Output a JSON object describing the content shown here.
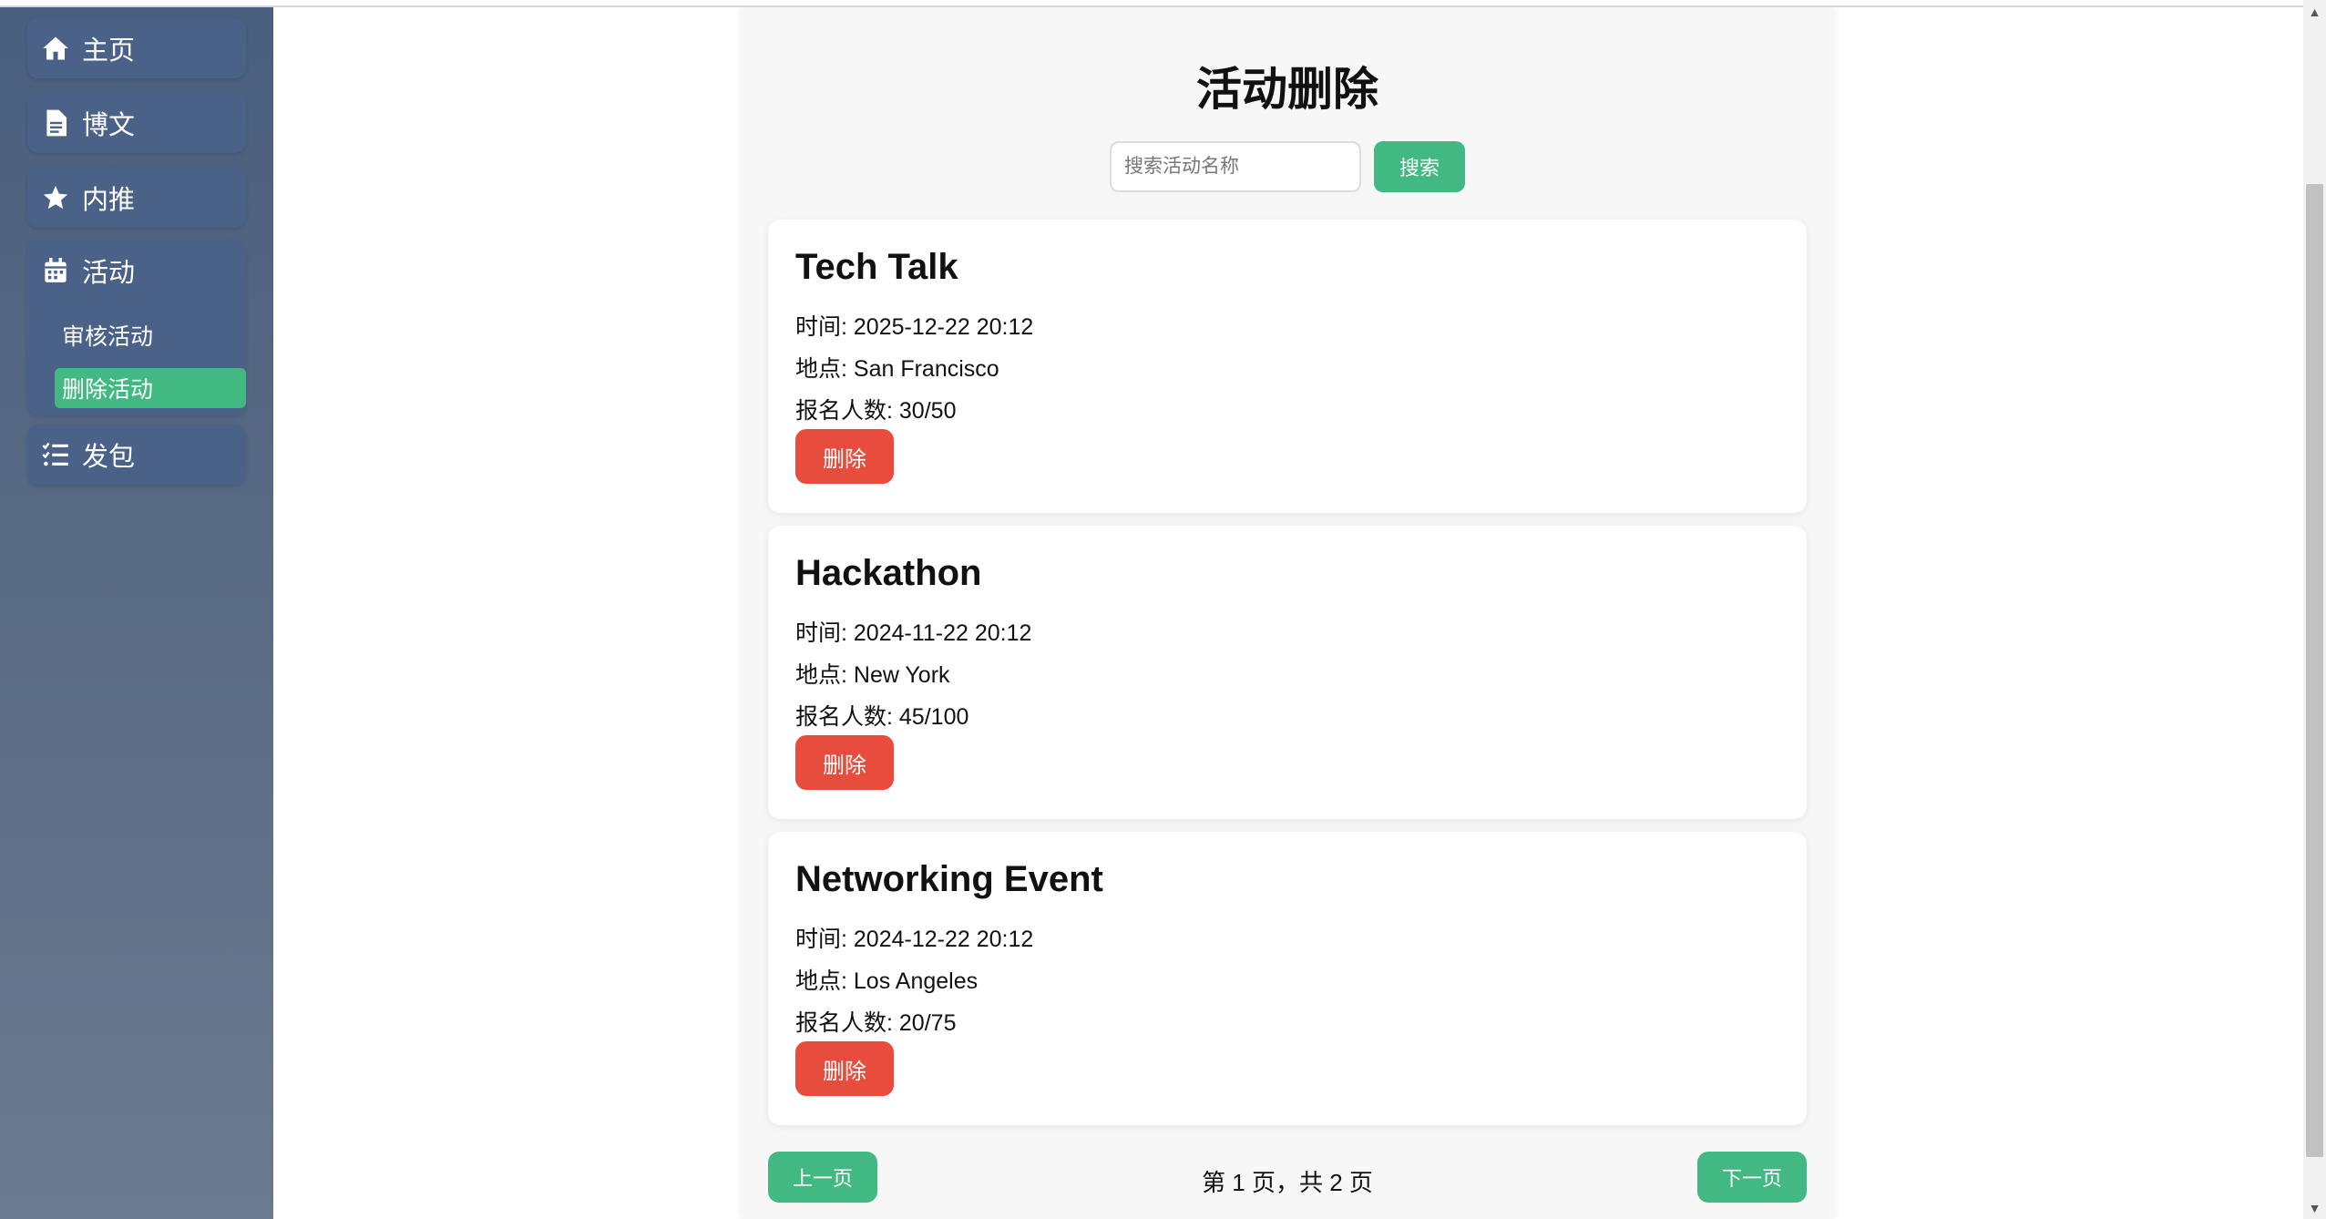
{
  "sidebar": {
    "items": [
      {
        "label": "主页",
        "icon": "home-icon"
      },
      {
        "label": "博文",
        "icon": "document-icon"
      },
      {
        "label": "内推",
        "icon": "star-icon"
      }
    ],
    "activity": {
      "label": "活动",
      "icon": "calendar-icon",
      "sub_items": [
        {
          "label": "审核活动",
          "active": false
        },
        {
          "label": "删除活动",
          "active": true
        }
      ]
    },
    "bottom_item": {
      "label": "发包",
      "icon": "checklist-icon"
    }
  },
  "main": {
    "title": "活动删除",
    "search": {
      "placeholder": "搜索活动名称",
      "value": "",
      "button_label": "搜索"
    },
    "events": [
      {
        "name": "Tech Talk",
        "time_label": "时间: ",
        "time": "2025-12-22 20:12",
        "location_label": "地点: ",
        "location": "San Francisco",
        "signup_label": "报名人数: ",
        "signup": "30/50",
        "delete_label": "删除"
      },
      {
        "name": "Hackathon",
        "time_label": "时间: ",
        "time": "2024-11-22 20:12",
        "location_label": "地点: ",
        "location": "New York",
        "signup_label": "报名人数: ",
        "signup": "45/100",
        "delete_label": "删除"
      },
      {
        "name": "Networking Event",
        "time_label": "时间: ",
        "time": "2024-12-22 20:12",
        "location_label": "地点: ",
        "location": "Los Angeles",
        "signup_label": "报名人数: ",
        "signup": "20/75",
        "delete_label": "删除"
      }
    ],
    "pagination": {
      "prev_label": "上一页",
      "next_label": "下一页",
      "info": "第 1 页，共 2 页"
    }
  },
  "colors": {
    "accent": "#42b983",
    "danger": "#e74c3c",
    "sidebar": "#4a6287"
  }
}
